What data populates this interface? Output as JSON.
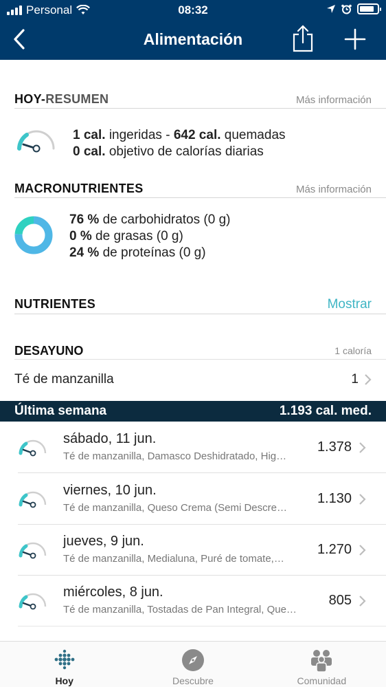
{
  "status_bar": {
    "carrier": "Personal",
    "time": "08:32",
    "battery_level": 0.85
  },
  "nav": {
    "title": "Alimentación"
  },
  "summary": {
    "heading_bold": "HOY-",
    "heading_light": "RESUMEN",
    "more_info": "Más información",
    "intake_value": "1 cal.",
    "intake_text": " ingeridas - ",
    "burned_value": "642 cal.",
    "burned_text": " quemadas",
    "goal_value": "0 cal.",
    "goal_text": " objetivo de calorías diarias"
  },
  "macros": {
    "heading": "MACRONUTRIENTES",
    "more_info": "Más información",
    "items": [
      {
        "pct": "76 %",
        "text": " de carbohidratos (0 g)"
      },
      {
        "pct": "0 %",
        "text": " de grasas (0 g)"
      },
      {
        "pct": "24 %",
        "text": " de proteínas (0 g)"
      }
    ],
    "donut": [
      {
        "label": "carbohidratos",
        "value": 76,
        "color": "#4fb7e6"
      },
      {
        "label": "grasas",
        "value": 0,
        "color": "#8fd6c8"
      },
      {
        "label": "proteínas",
        "value": 24,
        "color": "#2fd1c0"
      }
    ]
  },
  "nutrients": {
    "heading": "NUTRIENTES",
    "action": "Mostrar"
  },
  "breakfast": {
    "heading": "DESAYUNO",
    "calories": "1 caloría",
    "items": [
      {
        "name": "Té de manzanilla",
        "quantity": "1"
      }
    ]
  },
  "week": {
    "label": "Última semana",
    "average": "1.193 cal. med.",
    "days": [
      {
        "date": "sábado, 11 jun.",
        "foods": "Té de manzanilla, Damasco Deshidratado, Hig…",
        "value": "1.378"
      },
      {
        "date": "viernes, 10 jun.",
        "foods": "Té de manzanilla, Queso Crema (Semi Descre…",
        "value": "1.130"
      },
      {
        "date": "jueves, 9 jun.",
        "foods": "Té de manzanilla, Medialuna, Puré de tomate,…",
        "value": "1.270"
      },
      {
        "date": "miércoles, 8 jun.",
        "foods": "Té de manzanilla, Tostadas de Pan Integral, Que…",
        "value": "805"
      }
    ]
  },
  "tabs": [
    {
      "label": "Hoy",
      "icon": "dots-grid-icon"
    },
    {
      "label": "Descubre",
      "icon": "compass-icon"
    },
    {
      "label": "Comunidad",
      "icon": "people-icon"
    }
  ],
  "colors": {
    "header": "#003a6b",
    "week_band": "#0c2b3f",
    "accent": "#3fb5c4",
    "gauge_fill": "#3ec5c9"
  }
}
